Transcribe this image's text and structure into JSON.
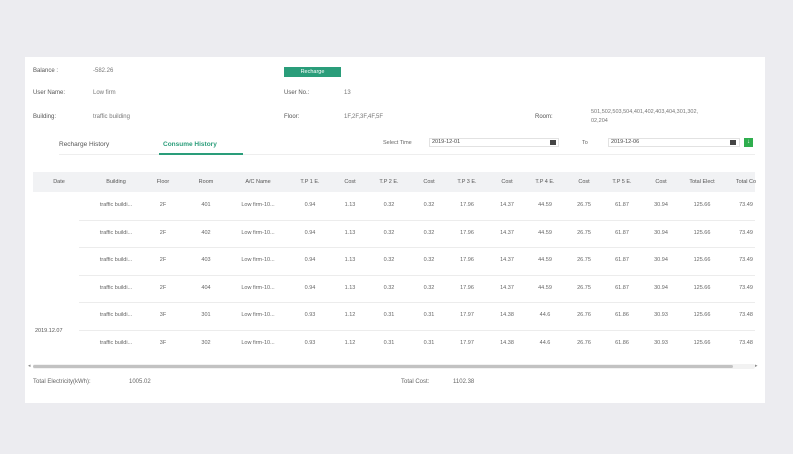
{
  "info": {
    "balance_label": "Balance :",
    "balance_value": "-582.26",
    "recharge_button": "Recharge",
    "user_name_label": "User Name:",
    "user_name_value": "Low firm",
    "user_no_label": "User No.:",
    "user_no_value": "13",
    "building_label": "Building:",
    "building_value": "traffic building",
    "floor_label": "Floor:",
    "floor_value": "1F,2F,3F,4F,5F",
    "room_label": "Room:",
    "room_value_line1": "501,502,503,504,401,402,403,404,301,302,",
    "room_value_line2": "02,204"
  },
  "tabs": [
    {
      "label": "Recharge History"
    },
    {
      "label": "Consume History"
    }
  ],
  "date_filter": {
    "select_time_label": "Select Time",
    "start_date": "2019-12-01",
    "to_label": "To",
    "end_date": "2019-12-06"
  },
  "table": {
    "headers": [
      "Date",
      "Building",
      "Floor",
      "Room",
      "A/C Name",
      "T.P 1 E.",
      "Cost",
      "T.P 2 E.",
      "Cost",
      "T.P 3 E.",
      "Cost",
      "T.P 4 E.",
      "Cost",
      "T.P 5 E.",
      "Cost",
      "Total Elect",
      "Total Co"
    ],
    "date_value": "2019.12.07",
    "rows": [
      [
        "traffic buildi...",
        "2F",
        "401",
        "Low firm-10...",
        "0.94",
        "1.13",
        "0.32",
        "0.32",
        "17.96",
        "14.37",
        "44.59",
        "26.75",
        "61.87",
        "30.94",
        "125.66",
        "73.49"
      ],
      [
        "traffic buildi...",
        "2F",
        "402",
        "Low firm-10...",
        "0.94",
        "1.13",
        "0.32",
        "0.32",
        "17.96",
        "14.37",
        "44.59",
        "26.75",
        "61.87",
        "30.94",
        "125.66",
        "73.49"
      ],
      [
        "traffic buildi...",
        "2F",
        "403",
        "Low firm-10...",
        "0.94",
        "1.13",
        "0.32",
        "0.32",
        "17.96",
        "14.37",
        "44.59",
        "26.75",
        "61.87",
        "30.94",
        "125.66",
        "73.49"
      ],
      [
        "traffic buildi...",
        "2F",
        "404",
        "Low firm-10...",
        "0.94",
        "1.13",
        "0.32",
        "0.32",
        "17.96",
        "14.37",
        "44.59",
        "26.75",
        "61.87",
        "30.94",
        "125.66",
        "73.49"
      ],
      [
        "traffic buildi...",
        "3F",
        "301",
        "Low firm-10...",
        "0.93",
        "1.12",
        "0.31",
        "0.31",
        "17.97",
        "14.38",
        "44.6",
        "26.76",
        "61.86",
        "30.93",
        "125.66",
        "73.48"
      ],
      [
        "traffic buildi...",
        "3F",
        "302",
        "Low firm-10...",
        "0.93",
        "1.12",
        "0.31",
        "0.31",
        "17.97",
        "14.38",
        "44.6",
        "26.76",
        "61.86",
        "30.93",
        "125.66",
        "73.48"
      ]
    ]
  },
  "footer": {
    "total_electricity_label": "Total Electricity(kWh):",
    "total_electricity_value": "1005.02",
    "total_cost_label": "Total Cost:",
    "total_cost_value": "1102.38"
  },
  "colors": {
    "accent": "#2a9d7a",
    "header_bg": "#f1f2f4",
    "page_bg": "#ececf0"
  },
  "icons": [
    "calendar-icon",
    "calendar-icon",
    "export-icon",
    "scroll-left-icon",
    "scroll-right-icon"
  ]
}
